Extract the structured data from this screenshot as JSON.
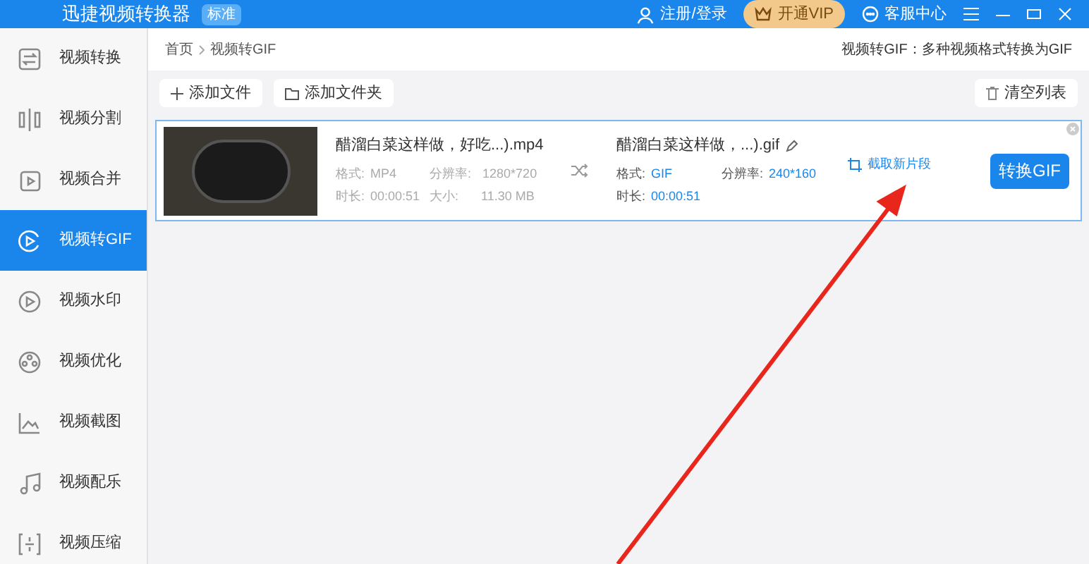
{
  "window": {
    "title": "迅捷视频转换器",
    "badge": "标准"
  },
  "header": {
    "login": "注册/登录",
    "vip": "开通VIP",
    "service": "客服中心"
  },
  "sidebar": {
    "items": [
      {
        "label": "视频转换",
        "selected": false
      },
      {
        "label": "视频分割",
        "selected": false
      },
      {
        "label": "视频合并",
        "selected": false
      },
      {
        "label": "视频转GIF",
        "selected": true
      },
      {
        "label": "视频水印",
        "selected": false
      },
      {
        "label": "视频优化",
        "selected": false
      },
      {
        "label": "视频截图",
        "selected": false
      },
      {
        "label": "视频配乐",
        "selected": false
      },
      {
        "label": "视频压缩",
        "selected": false
      }
    ]
  },
  "breadcrumb": [
    "首页",
    "视频转GIF"
  ],
  "description": "视频转GIF：多种视频格式转换为GIF",
  "toolbar": {
    "add_file": "添加文件",
    "add_folder": "添加文件夹",
    "clear": "清空列表"
  },
  "file": {
    "source_name": "醋溜白菜这样做，好吃...).mp4",
    "format_label": "格式:",
    "format": "MP4",
    "resolution_label": "分辨率:",
    "resolution": "1280*720",
    "duration_label": "时长:",
    "duration": "00:00:51",
    "size_label": "大小:",
    "size": "11.30 MB",
    "output_name": "醋溜白菜这样做，...).gif",
    "out_format_label": "格式:",
    "out_format": "GIF",
    "out_resolution_label": "分辨率:",
    "out_resolution": "240*160",
    "out_duration_label": "时长:",
    "out_duration": "00:00:51",
    "clip": "截取新片段",
    "convert": "转换GIF"
  }
}
